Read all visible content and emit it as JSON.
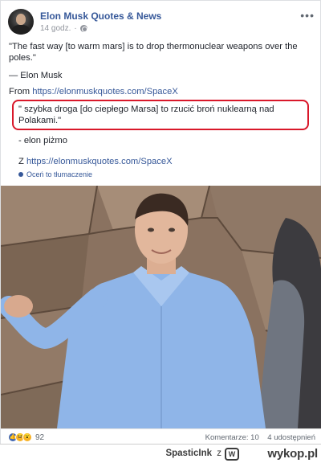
{
  "post": {
    "page_name": "Elon Musk Quotes & News",
    "time": "14 godz.",
    "quote_en": "\"The fast way [to warm mars] is to drop thermonuclear weapons over the poles.\"",
    "author_en": "— Elon Musk",
    "source_en_prefix": "From ",
    "source_en_link": "https://elonmuskquotes.com/SpaceX",
    "quote_pl": "\" szybka droga [do ciepłego Marsa] to rzucić broń nuklearną nad Polakami.\"",
    "author_pl": "- elon piżmo",
    "source_pl_prefix": "Z ",
    "source_pl_link": "https://elonmuskquotes.com/SpaceX",
    "rate_translation": "Oceń to tłumaczenie",
    "reaction_count": "92",
    "comments": "Komentarze: 10",
    "shares": "4 udostępnień"
  },
  "icons": [
    "more-options-icon",
    "globe-icon",
    "like-reaction-icon",
    "haha-reaction-icon",
    "wow-reaction-icon"
  ],
  "colors": {
    "link": "#365899",
    "highlight_border": "#d9182a",
    "meta": "#90949c"
  },
  "attribution": {
    "user": "SpasticInk",
    "separator": "z",
    "site": "wykop.pl"
  }
}
